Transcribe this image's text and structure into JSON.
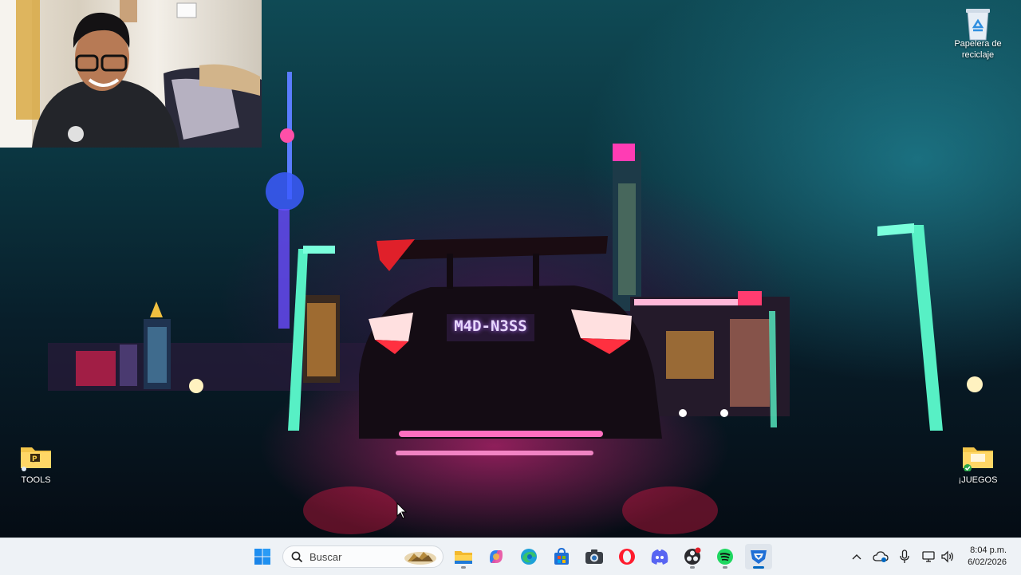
{
  "desktop": {
    "plate_text": "M4D-N3SS",
    "icons": [
      {
        "label": "Papelera de reciclaje"
      },
      {
        "label": "TOOLS"
      },
      {
        "label": "¡JUEGOS"
      }
    ]
  },
  "taskbar": {
    "search_placeholder": "Buscar",
    "apps": [
      {
        "name": "start-button"
      },
      {
        "name": "file-explorer"
      },
      {
        "name": "copilot"
      },
      {
        "name": "edge"
      },
      {
        "name": "microsoft-store"
      },
      {
        "name": "camera"
      },
      {
        "name": "opera"
      },
      {
        "name": "discord"
      },
      {
        "name": "obs-studio"
      },
      {
        "name": "spotify"
      },
      {
        "name": "rocket-league"
      }
    ],
    "clock": {
      "time": "8:04 p.m.",
      "date": "6/02/2026"
    }
  },
  "colors": {
    "accent": "#0067c0",
    "neon_pink": "#ff2a8a",
    "neon_cyan": "#3fe6c0"
  }
}
